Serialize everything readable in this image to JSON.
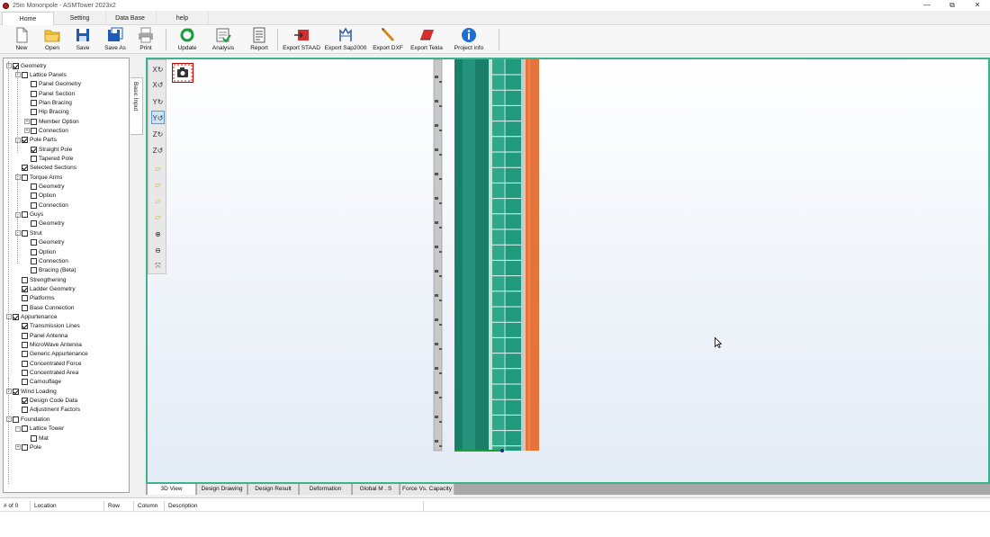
{
  "window": {
    "title": "25m Mononpole - ASMTower 2023x2",
    "minimize": "—",
    "restore": "⧉",
    "close": "✕"
  },
  "ribbon": {
    "tabs": [
      "Home",
      "Setting",
      "Data Base",
      "help"
    ],
    "active_tab": "Home"
  },
  "toolbar": {
    "buttons": [
      {
        "label": "New",
        "icon": "new-file-icon"
      },
      {
        "label": "Open",
        "icon": "open-folder-icon"
      },
      {
        "label": "Save",
        "icon": "save-icon"
      },
      {
        "label": "Save As",
        "icon": "save-as-icon"
      },
      {
        "label": "Print",
        "icon": "print-icon"
      },
      {
        "label": "Update",
        "icon": "update-icon"
      },
      {
        "label": "Analysis",
        "icon": "analysis-icon"
      },
      {
        "label": "Report",
        "icon": "report-icon"
      },
      {
        "label": "Export STAAD",
        "icon": "export-staad-icon"
      },
      {
        "label": "Export Sap2000",
        "icon": "export-sap2000-icon"
      },
      {
        "label": "Export DXF",
        "icon": "export-dxf-icon"
      },
      {
        "label": "Export Tekla",
        "icon": "export-tekla-icon"
      },
      {
        "label": "Project info",
        "icon": "info-icon"
      }
    ]
  },
  "side_tab": {
    "label": "Basic Input"
  },
  "tree": [
    {
      "label": "Geometry",
      "checked": true,
      "level": 0,
      "expander": "-"
    },
    {
      "label": "Lattice Panels",
      "checked": false,
      "level": 1,
      "expander": "-"
    },
    {
      "label": "Panel Geometry",
      "checked": false,
      "level": 2,
      "expander": ""
    },
    {
      "label": "Panel Section",
      "checked": false,
      "level": 2,
      "expander": ""
    },
    {
      "label": "Plan Bracing",
      "checked": false,
      "level": 2,
      "expander": ""
    },
    {
      "label": "Hip Bracing",
      "checked": false,
      "level": 2,
      "expander": ""
    },
    {
      "label": "Member Option",
      "checked": false,
      "level": 2,
      "expander": "+"
    },
    {
      "label": "Connection",
      "checked": false,
      "level": 2,
      "expander": "+"
    },
    {
      "label": "Pole Parts",
      "checked": true,
      "level": 1,
      "expander": "-"
    },
    {
      "label": "Straight Pole",
      "checked": true,
      "level": 2,
      "expander": ""
    },
    {
      "label": "Tapered Pole",
      "checked": false,
      "level": 2,
      "expander": ""
    },
    {
      "label": "Selected Sections",
      "checked": true,
      "level": 1,
      "expander": ""
    },
    {
      "label": "Torque Arms",
      "checked": false,
      "level": 1,
      "expander": "-"
    },
    {
      "label": "Geometry",
      "checked": false,
      "level": 2,
      "expander": ""
    },
    {
      "label": "Option",
      "checked": false,
      "level": 2,
      "expander": ""
    },
    {
      "label": "Connection",
      "checked": false,
      "level": 2,
      "expander": ""
    },
    {
      "label": "Guys",
      "checked": false,
      "level": 1,
      "expander": "-"
    },
    {
      "label": "Geometry",
      "checked": false,
      "level": 2,
      "expander": ""
    },
    {
      "label": "Strut",
      "checked": false,
      "level": 1,
      "expander": "-"
    },
    {
      "label": "Geometry",
      "checked": false,
      "level": 2,
      "expander": ""
    },
    {
      "label": "Option",
      "checked": false,
      "level": 2,
      "expander": ""
    },
    {
      "label": "Connection",
      "checked": false,
      "level": 2,
      "expander": ""
    },
    {
      "label": "Bracing (Beta)",
      "checked": false,
      "level": 2,
      "expander": ""
    },
    {
      "label": "Strengthening",
      "checked": false,
      "level": 1,
      "expander": ""
    },
    {
      "label": "Ladder Geometry",
      "checked": true,
      "level": 1,
      "expander": ""
    },
    {
      "label": "Platforms",
      "checked": false,
      "level": 1,
      "expander": ""
    },
    {
      "label": "Base Connection",
      "checked": false,
      "level": 1,
      "expander": ""
    },
    {
      "label": "Appurtenance",
      "checked": true,
      "level": 0,
      "expander": "-"
    },
    {
      "label": "Transmission Lines",
      "checked": true,
      "level": 1,
      "expander": ""
    },
    {
      "label": "Panel Antenna",
      "checked": false,
      "level": 1,
      "expander": ""
    },
    {
      "label": "MicroWave Antenna",
      "checked": false,
      "level": 1,
      "expander": ""
    },
    {
      "label": "Generic Appurtenance",
      "checked": false,
      "level": 1,
      "expander": ""
    },
    {
      "label": "Concentrated Force",
      "checked": false,
      "level": 1,
      "expander": ""
    },
    {
      "label": "Concentrated Area",
      "checked": false,
      "level": 1,
      "expander": ""
    },
    {
      "label": "Camouflage",
      "checked": false,
      "level": 1,
      "expander": ""
    },
    {
      "label": "Wind Loading",
      "checked": true,
      "level": 0,
      "expander": "-"
    },
    {
      "label": "Design Code Data",
      "checked": true,
      "level": 1,
      "expander": ""
    },
    {
      "label": "Adjustment Factors",
      "checked": false,
      "level": 1,
      "expander": ""
    },
    {
      "label": "Foundation",
      "checked": false,
      "level": 0,
      "expander": "-"
    },
    {
      "label": "Lattice Tower",
      "checked": false,
      "level": 1,
      "expander": "-"
    },
    {
      "label": "Mat",
      "checked": false,
      "level": 2,
      "expander": ""
    },
    {
      "label": "Pole",
      "checked": false,
      "level": 1,
      "expander": "+"
    }
  ],
  "view_tools": [
    {
      "icon": "rotate-x-cw-icon",
      "glyph": "X↻",
      "selected": false
    },
    {
      "icon": "rotate-x-ccw-icon",
      "glyph": "X↺",
      "selected": false
    },
    {
      "icon": "rotate-y-cw-icon",
      "glyph": "Y↻",
      "selected": false
    },
    {
      "icon": "rotate-y-ccw-icon",
      "glyph": "Y↺",
      "selected": true
    },
    {
      "icon": "rotate-z-cw-icon",
      "glyph": "Z↻",
      "selected": false
    },
    {
      "icon": "rotate-z-ccw-icon",
      "glyph": "Z↺",
      "selected": false
    },
    {
      "icon": "front-view-icon",
      "glyph": "▱",
      "selected": false
    },
    {
      "icon": "side-view-icon",
      "glyph": "▱",
      "selected": false
    },
    {
      "icon": "top-view-icon",
      "glyph": "▱",
      "selected": false
    },
    {
      "icon": "iso-view-icon",
      "glyph": "▱",
      "selected": false
    },
    {
      "icon": "zoom-in-icon",
      "glyph": "⊕",
      "selected": false
    },
    {
      "icon": "zoom-out-icon",
      "glyph": "⊖",
      "selected": false
    },
    {
      "icon": "zoom-extents-icon",
      "glyph": "⤧",
      "selected": false
    }
  ],
  "model_colors": {
    "pole_dark": "#1a7f68",
    "pole_light": "#2aa288",
    "ladder": "#1f9a7c",
    "line_panel": "#e8733a",
    "rail": "#c8c8c8",
    "viewport_border": "#3cb28e"
  },
  "view_tabs": [
    "3D View",
    "Design Drawing",
    "Design Result",
    "Deformation",
    "Global M . S",
    "Force Vs. Capacity"
  ],
  "active_view_tab": "3D View",
  "messages": {
    "columns": [
      "# of 0",
      "Location",
      "Row",
      "Column",
      "Description"
    ]
  }
}
